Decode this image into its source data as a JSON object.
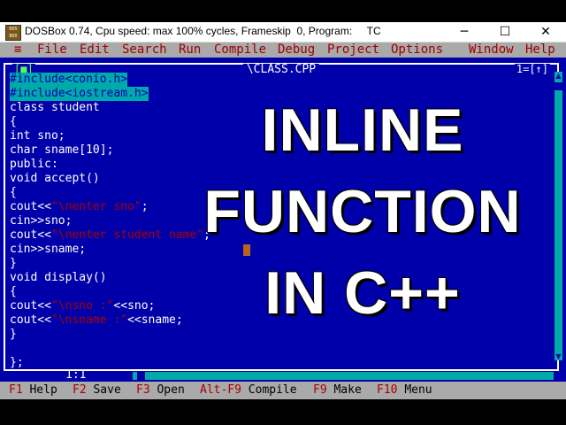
{
  "window": {
    "title": "DOSBox 0.74, Cpu speed: max 100% cycles, Frameskip  0, Program:     TC",
    "icon": "dosbox-app-icon",
    "minimize_glyph": "─",
    "maximize_glyph": "☐",
    "close_glyph": "✕"
  },
  "menu": {
    "system": "≡",
    "items": [
      "File",
      "Edit",
      "Search",
      "Run",
      "Compile",
      "Debug",
      "Project",
      "Options",
      "Window",
      "Help"
    ]
  },
  "editor": {
    "filename": "\\CLASS.CPP",
    "close_box": "[■]",
    "window_number": "1=[↑]",
    "cursor_position": "1:1",
    "code_lines": [
      "#include<conio.h>",
      "#include<iostream.h>",
      "class student",
      "{",
      "int sno;",
      "char sname[10];",
      "public:",
      "void accept()",
      "{",
      "cout<<\"\\nenter sno\";",
      "cin>>sno;",
      "cout<<\"\\nenter student name\";",
      "cin>>sname;",
      "}",
      "void display()",
      "{",
      "cout<<\"\\nsno :\"<<sno;",
      "cout<<\"\\nsname :\"<<sname;",
      "}",
      "",
      "};"
    ]
  },
  "overlay": {
    "line1": "INLINE",
    "line2": "FUNCTION",
    "line3": "IN C++"
  },
  "status_bar": [
    {
      "key": "F1",
      "label": "Help"
    },
    {
      "key": "F2",
      "label": "Save"
    },
    {
      "key": "F3",
      "label": "Open"
    },
    {
      "key": "Alt-F9",
      "label": "Compile"
    },
    {
      "key": "F9",
      "label": "Make"
    },
    {
      "key": "F10",
      "label": "Menu"
    }
  ],
  "colors": {
    "editor_bg": "#0000aa",
    "menu_bg": "#aaaaaa",
    "hotkey": "#aa0000",
    "highlight": "#00aaaa"
  }
}
